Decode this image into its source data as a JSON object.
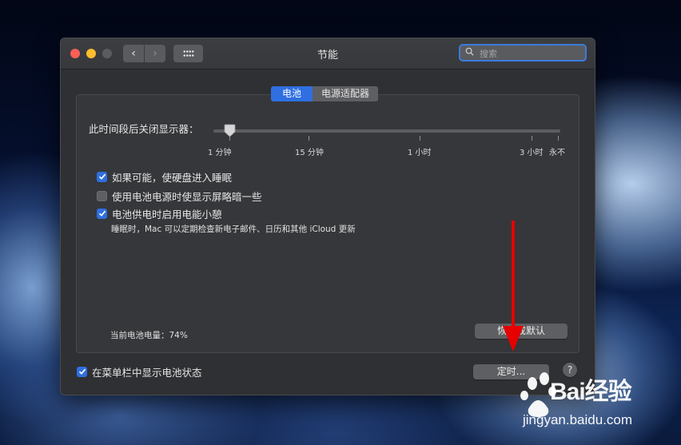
{
  "window": {
    "title": "节能",
    "search_placeholder": "搜索",
    "nav": {
      "back_glyph": "‹",
      "forward_glyph": "›"
    }
  },
  "tabs": [
    {
      "label": "电池",
      "active": true
    },
    {
      "label": "电源适配器",
      "active": false
    }
  ],
  "slider": {
    "label": "此时间段后关闭显示器：",
    "value": "1 分钟",
    "ticks": [
      "1 分钟",
      "15 分钟",
      "1 小时",
      "3 小时",
      "永不"
    ]
  },
  "options": [
    {
      "label": "如果可能，使硬盘进入睡眠",
      "checked": true
    },
    {
      "label": "使用电池电源时使显示屏略暗一些",
      "checked": false
    },
    {
      "label": "电池供电时启用电能小憩",
      "checked": true
    }
  ],
  "hint": "睡眠时，Mac 可以定期检查新电子邮件、日历和其他 iCloud 更新",
  "battery_level": "当前电池电量：74%",
  "buttons": {
    "restore": "恢复成默认",
    "schedule": "定时...",
    "help": "?"
  },
  "menubar_option": {
    "label": "在菜单栏中显示电池状态",
    "checked": true
  },
  "colors": {
    "accent": "#2f6fe0",
    "annotation_arrow": "#e60000"
  },
  "watermark": {
    "brand": "Bai经验",
    "url": "jingyan.baidu.com"
  }
}
